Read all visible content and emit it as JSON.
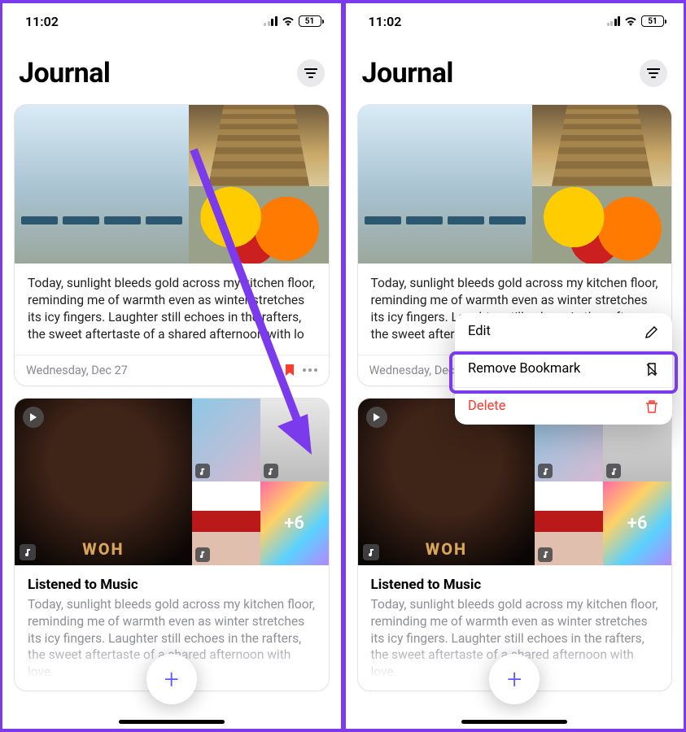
{
  "status": {
    "time": "11:02",
    "battery": "51"
  },
  "header": {
    "title": "Journal"
  },
  "entry1": {
    "text": "Today, sunlight bleeds gold across my kitchen floor, reminding me of warmth even as winter stretches its icy fingers. Laughter still echoes in the rafters, the sweet aftertaste of a shared afternoon with lo",
    "text_truncated": "Today, sunlight bleeds gold across my kitchen floor, reminding me of warmth even as winter stretches its icy fingers. Laughter still echoes in the rafters, the sweet aftertaste of a shared afternoon with love.",
    "date": "Wednesday, Dec 27"
  },
  "entry2": {
    "title": "Listened to Music",
    "sub": "Today, sunlight bleeds gold across my kitchen floor, reminding me of warmth even as winter stretches its icy fingers. Laughter still echoes in the rafters, the sweet aftertaste of a shared afternoon with love.",
    "more_count": "+6",
    "album_woh": "WOH"
  },
  "menu": {
    "edit": "Edit",
    "remove": "Remove Bookmark",
    "delete": "Delete"
  },
  "right_entry_text": "Today, sunlight bleeds gold across my kitchen floor, reminding me of warmth even as winter stretches its icy fingers. Laughter still echoes in the rafters, the sweet aftertaste o"
}
